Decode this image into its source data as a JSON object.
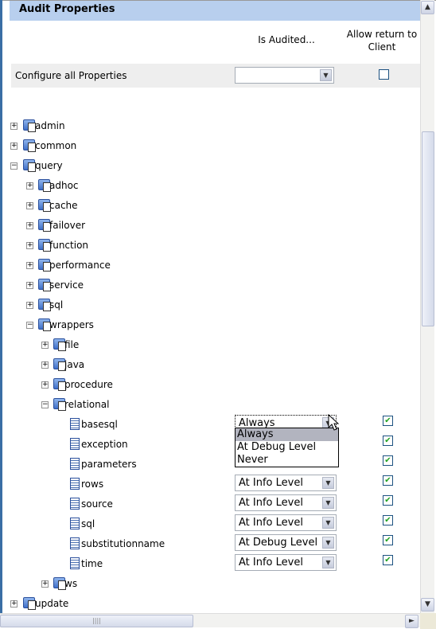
{
  "header": {
    "title": "Audit Properties"
  },
  "columns": {
    "audited": "Is Audited...",
    "allow_return_l1": "Allow return to",
    "allow_return_l2": "Client"
  },
  "configure_all": {
    "label": "Configure all Properties",
    "value": "",
    "allow_return": false
  },
  "tree": [
    {
      "label": "admin",
      "level": 0,
      "type": "folder",
      "expanded": false
    },
    {
      "label": "common",
      "level": 0,
      "type": "folder",
      "expanded": false
    },
    {
      "label": "query",
      "level": 0,
      "type": "folder",
      "expanded": true
    },
    {
      "label": "adhoc",
      "level": 1,
      "type": "folder",
      "expanded": false
    },
    {
      "label": "cache",
      "level": 1,
      "type": "folder",
      "expanded": false
    },
    {
      "label": "failover",
      "level": 1,
      "type": "folder",
      "expanded": false
    },
    {
      "label": "function",
      "level": 1,
      "type": "folder",
      "expanded": false
    },
    {
      "label": "performance",
      "level": 1,
      "type": "folder",
      "expanded": false
    },
    {
      "label": "service",
      "level": 1,
      "type": "folder",
      "expanded": false
    },
    {
      "label": "sql",
      "level": 1,
      "type": "folder",
      "expanded": false
    },
    {
      "label": "wrappers",
      "level": 1,
      "type": "folder",
      "expanded": true
    },
    {
      "label": "file",
      "level": 2,
      "type": "folder",
      "expanded": false
    },
    {
      "label": "java",
      "level": 2,
      "type": "folder",
      "expanded": false
    },
    {
      "label": "procedure",
      "level": 2,
      "type": "folder",
      "expanded": false
    },
    {
      "label": "relational",
      "level": 2,
      "type": "folder",
      "expanded": true
    },
    {
      "label": "basesql",
      "level": 3,
      "type": "property",
      "audited": "Always",
      "allow_return": true
    },
    {
      "label": "exception",
      "level": 3,
      "type": "property",
      "allow_return": true
    },
    {
      "label": "parameters",
      "level": 3,
      "type": "property",
      "allow_return": true
    },
    {
      "label": "rows",
      "level": 3,
      "type": "property",
      "audited": "At Info Level",
      "allow_return": true
    },
    {
      "label": "source",
      "level": 3,
      "type": "property",
      "audited": "At Info Level",
      "allow_return": true
    },
    {
      "label": "sql",
      "level": 3,
      "type": "property",
      "audited": "At Info Level",
      "allow_return": true
    },
    {
      "label": "substitutionname",
      "level": 3,
      "type": "property",
      "audited": "At Debug Level",
      "allow_return": true
    },
    {
      "label": "time",
      "level": 3,
      "type": "property",
      "audited": "At Info Level",
      "allow_return": true
    },
    {
      "label": "ws",
      "level": 2,
      "type": "folder",
      "expanded": false
    },
    {
      "label": "update",
      "level": 0,
      "type": "folder",
      "expanded": false
    }
  ],
  "open_dropdown": {
    "options": [
      "Always",
      "At Debug Level",
      "Never"
    ],
    "highlighted": "Always"
  },
  "icons": {
    "folder": "property-folder-icon",
    "property": "property-icon",
    "check": "✔",
    "arrow_down": "▼",
    "arrow_up": "▲",
    "arrow_right": "►"
  },
  "colors": {
    "header_bg": "#b8cfee",
    "check": "#21a121",
    "highlight": "#b2b4bf"
  }
}
